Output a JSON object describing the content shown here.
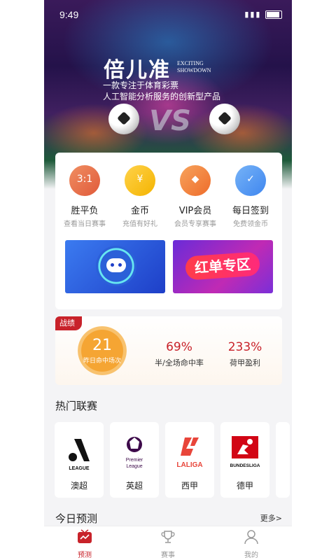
{
  "status_bar": {
    "time": "9:49",
    "icons": "N ⏰ 📶 ▮▮▮"
  },
  "hero": {
    "logo_text": "倍儿准",
    "logo_sub_line1": "EXCITING",
    "logo_sub_line2": "SHOWDOWN",
    "tagline_line1": "一款专注于体育彩票",
    "tagline_line2": "人工智能分析服务的创新型产品",
    "vs_text": "VS"
  },
  "quick_actions": [
    {
      "icon": "calendar-icon",
      "icon_text": "3:1",
      "title": "胜平负",
      "subtitle": "查看当日赛事"
    },
    {
      "icon": "coin-icon",
      "icon_text": "¥",
      "title": "金币",
      "subtitle": "充值有好礼"
    },
    {
      "icon": "diamond-icon",
      "icon_text": "◆",
      "title": "VIP会员",
      "subtitle": "会员专享赛事"
    },
    {
      "icon": "checkin-icon",
      "icon_text": "✓",
      "title": "每日签到",
      "subtitle": "免费领金币"
    }
  ],
  "banners": {
    "red_zone_text": "红单专区"
  },
  "record": {
    "tag": "战绩",
    "hits": "21",
    "hits_label": "昨日命中场次",
    "stat1_value": "69%",
    "stat1_label": "半/全场命中率",
    "stat2_value": "233%",
    "stat2_label": "荷甲盈利"
  },
  "hot_leagues": {
    "title": "热门联赛",
    "items": [
      {
        "name": "澳超",
        "logo_text": "LEAGUE"
      },
      {
        "name": "英超",
        "logo_text": "Premier League"
      },
      {
        "name": "西甲",
        "logo_text": "LALIGA"
      },
      {
        "name": "德甲",
        "logo_text": "BUNDESLIGA"
      }
    ]
  },
  "today": {
    "title": "今日预测",
    "more": "更多>"
  },
  "tabs": [
    {
      "label": "预测",
      "active": true
    },
    {
      "label": "赛事",
      "active": false
    },
    {
      "label": "我的",
      "active": false
    }
  ],
  "colors": {
    "accent": "#c8222a",
    "orange": "#f5a533"
  }
}
